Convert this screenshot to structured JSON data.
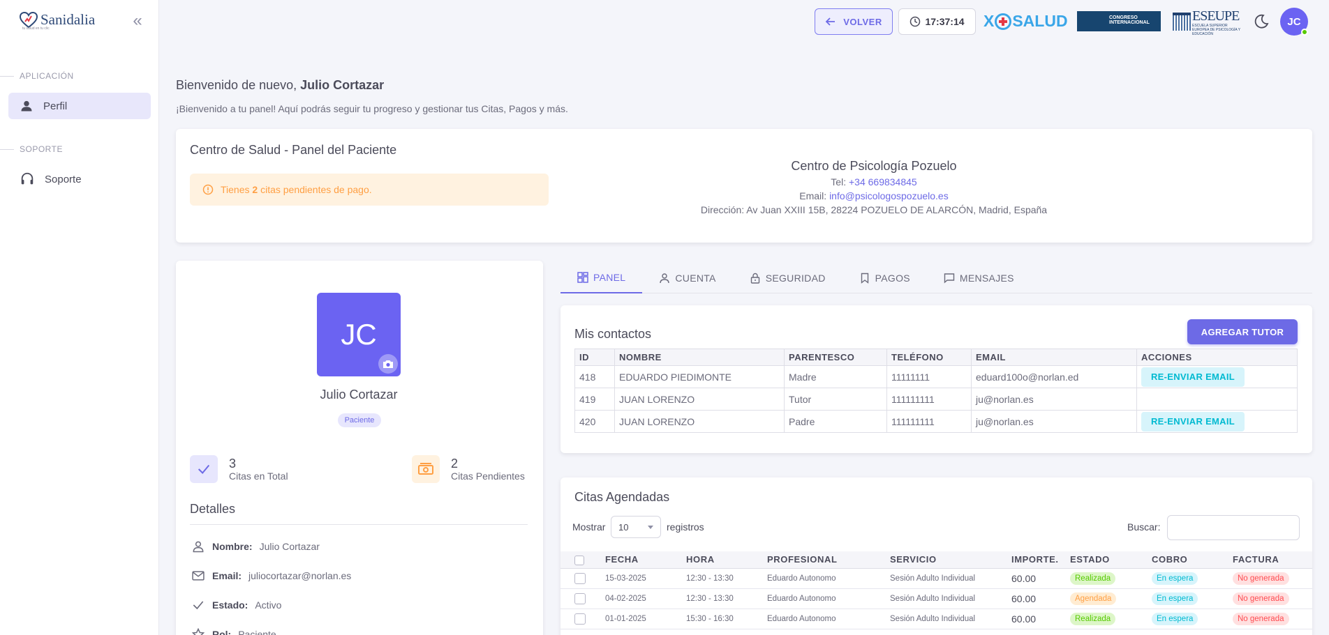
{
  "sidebar": {
    "brand": "Sanidalia",
    "brand_tagline": "tu salud en tu clic",
    "sections": [
      {
        "label": "APLICACIÓN",
        "items": [
          {
            "label": "Perfil",
            "icon": "user-icon"
          }
        ]
      },
      {
        "label": "SOPORTE",
        "items": [
          {
            "label": "Soporte",
            "icon": "headset-icon"
          }
        ]
      }
    ]
  },
  "header": {
    "back_label": "VOLVER",
    "clock": "17:37:14",
    "logo_xo_left": "X",
    "logo_xo_right": "SALUD",
    "logo_congreso": "CONGRESO INTERNACIONAL",
    "logo_eseupe": "ESEUPE",
    "logo_eseupe_sub": "ESCUELA SUPERIOR EUROPEA DE PSICOLOGÍA Y EDUCACIÓN",
    "user_initials": "JC"
  },
  "welcome": {
    "prefix": "Bienvenido de nuevo, ",
    "name": "Julio Cortazar",
    "subtitle": "¡Bienvenido a tu panel! Aquí podrás seguir tu progreso y gestionar tus Citas, Pagos y más."
  },
  "center_card": {
    "title": "Centro de Salud - Panel del Paciente",
    "alert_prefix": "Tienes ",
    "alert_count": "2",
    "alert_suffix": " citas pendientes de pago.",
    "center_name": "Centro de Psicología Pozuelo",
    "tel_label": "Tel: ",
    "tel": "+34 669834845",
    "email_label": "Email: ",
    "email": "info@psicologospozuelo.es",
    "address": "Dirección: Av Juan XXIII 15B, 28224 POZUELO DE ALARCÓN, Madrid, España"
  },
  "profile": {
    "initials": "JC",
    "name": "Julio Cortazar",
    "role": "Paciente",
    "stats": [
      {
        "value": "3",
        "label": "Citas en Total"
      },
      {
        "value": "2",
        "label": "Citas Pendientes"
      }
    ],
    "details_title": "Detalles",
    "details": [
      {
        "key": "Nombre:",
        "value": "Julio Cortazar"
      },
      {
        "key": "Email:",
        "value": "juliocortazar@norlan.es"
      },
      {
        "key": "Estado:",
        "value": "Activo"
      },
      {
        "key": "Rol:",
        "value": "Paciente"
      }
    ]
  },
  "tabs": [
    {
      "label": "PANEL",
      "active": true
    },
    {
      "label": "CUENTA",
      "active": false
    },
    {
      "label": "SEGURIDAD",
      "active": false
    },
    {
      "label": "PAGOS",
      "active": false
    },
    {
      "label": "MENSAJES",
      "active": false
    }
  ],
  "contacts": {
    "title": "Mis contactos",
    "add_button": "AGREGAR TUTOR",
    "columns": [
      "ID",
      "NOMBRE",
      "PARENTESCO",
      "TELÉFONO",
      "EMAIL",
      "ACCIONES"
    ],
    "rows": [
      {
        "id": "418",
        "name": "EDUARDO PIEDIMONTE",
        "rel": "Madre",
        "phone": "11111111",
        "email": "eduard100o@norlan.ed",
        "action": "RE-ENVIAR EMAIL"
      },
      {
        "id": "419",
        "name": "JUAN LORENZO",
        "rel": "Tutor",
        "phone": "111111111",
        "email": "ju@norlan.es",
        "action": ""
      },
      {
        "id": "420",
        "name": "JUAN LORENZO",
        "rel": "Padre",
        "phone": "111111111",
        "email": "ju@norlan.es",
        "action": "RE-ENVIAR EMAIL"
      }
    ]
  },
  "citas": {
    "title": "Citas Agendadas",
    "show_label": "Mostrar",
    "page_size": "10",
    "records_label": "registros",
    "search_label": "Buscar:",
    "search_value": "",
    "columns": [
      "FECHA",
      "HORA",
      "PROFESIONAL",
      "SERVICIO",
      "IMPORTE.",
      "ESTADO",
      "COBRO",
      "FACTURA"
    ],
    "rows": [
      {
        "fecha": "15-03-2025",
        "hora": "12:30 - 13:30",
        "profesional": "Eduardo Autonomo",
        "servicio": "Sesión Adulto Individual",
        "importe": "60.00",
        "estado": "Realizada",
        "cobro": "En espera",
        "factura": "No generada"
      },
      {
        "fecha": "04-02-2025",
        "hora": "12:30 - 13:30",
        "profesional": "Eduardo Autonomo",
        "servicio": "Sesión Adulto Individual",
        "importe": "60.00",
        "estado": "Agendada",
        "cobro": "En espera",
        "factura": "No generada"
      },
      {
        "fecha": "01-01-2025",
        "hora": "15:30 - 16:30",
        "profesional": "Eduardo Autonomo",
        "servicio": "Sesión Adulto Individual",
        "importe": "60.00",
        "estado": "Realizada",
        "cobro": "En espera",
        "factura": "No generada"
      }
    ]
  },
  "colors": {
    "primary": "#6d6ae6",
    "success": "#56ca00",
    "warning": "#ff9f43",
    "info": "#00bad1",
    "danger": "#ff4c51"
  }
}
